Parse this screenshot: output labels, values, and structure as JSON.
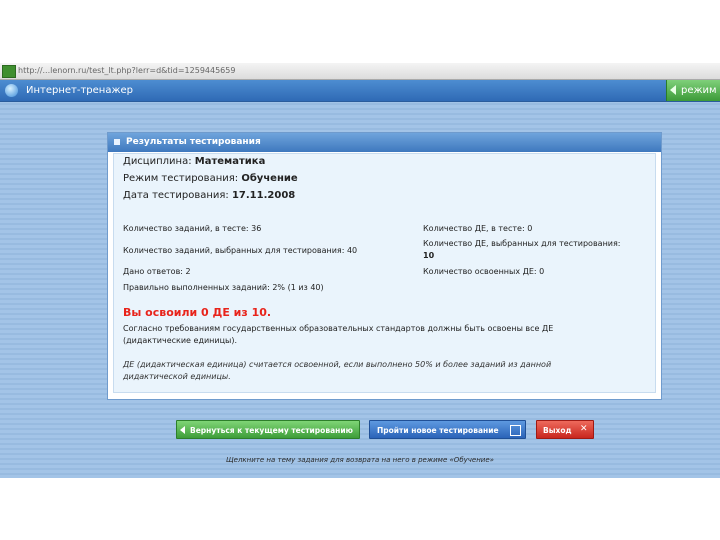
{
  "browser": {
    "url": "http://...lenorn.ru/test_lt.php?lerr=d&tid=1259445659"
  },
  "header": {
    "app_title": "Интернет-тренажер",
    "mode_button": "режим"
  },
  "results": {
    "panel_title": "Результаты тестирования",
    "discipline_label": "Дисциплина:",
    "discipline_value": "Математика",
    "mode_label": "Режим тестирования:",
    "mode_value": "Обучение",
    "date_label": "Дата тестирования:",
    "date_value": "17.11.2008",
    "tasks_in_test": "Количество заданий, в тесте: 36",
    "tasks_selected": "Количество заданий, выбранных для тестирования: 40",
    "answers_given": "Дано ответов: 2",
    "correct_answers": "Правильно выполненных заданий: 2% (1 из 40)",
    "de_in_test": "Количество ДЕ, в тесте: 0",
    "de_selected_line1": "Количество ДЕ, выбранных для тестирования:",
    "de_selected_line2": "10",
    "de_mastered": "Количество освоенных ДЕ: 0",
    "verdict": "Вы освоили 0 ДЕ из 10.",
    "standard_note_line1": "Согласно требованиям государственных образовательных стандартов должны быть освоены все ДЕ",
    "standard_note_line2": "(дидактические единицы).",
    "de_note_line1": "ДЕ (дидактическая единица) считается освоенной, если выполнено 50% и более заданий из данной",
    "de_note_line2": "дидактической единицы."
  },
  "actions": {
    "back_label": "Вернуться к текущему тестированию",
    "new_test_label": "Пройти новое тестирование",
    "exit_label": "Выход"
  },
  "footer": {
    "hint": "Щелкните на тему задания для возврата на него в режиме «Обучение»"
  },
  "colors": {
    "header_blue": "#2f6ab5",
    "accent_green": "#3d9d39",
    "accent_red": "#e8231a",
    "background": "#9ec0e4"
  }
}
